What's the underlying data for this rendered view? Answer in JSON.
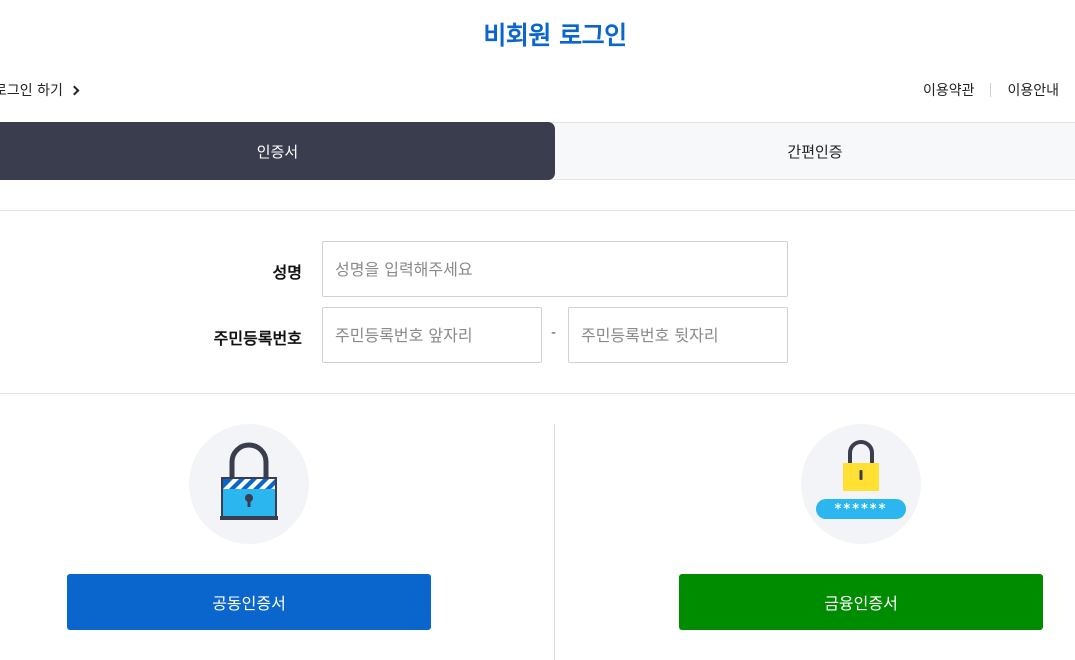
{
  "page": {
    "title": "비회원 로그인"
  },
  "header": {
    "member_login_label": "로그인 하기",
    "terms_label": "이용약관",
    "guide_label": "이용안내"
  },
  "tabs": [
    {
      "label": "인증서",
      "active": true
    },
    {
      "label": "간편인증",
      "active": false
    }
  ],
  "form": {
    "name_label": "성명",
    "name_placeholder": "성명을 입력해주세요",
    "rrn_label": "주민등록번호",
    "rrn_front_placeholder": "주민등록번호 앞자리",
    "rrn_separator": "-",
    "rrn_back_placeholder": "주민등록번호 뒷자리"
  },
  "certificates": [
    {
      "label": "공동인증서",
      "icon": "padlock-icon",
      "color": "#0a66cc"
    },
    {
      "label": "금융인증서",
      "icon": "password-lock-icon",
      "color": "#008c00",
      "password_mask": "******"
    }
  ],
  "colors": {
    "accent": "#0a66cc",
    "tab_active_bg": "#3a3d4d",
    "joint_cert": "#0a66cc",
    "financial_cert": "#008c00"
  }
}
